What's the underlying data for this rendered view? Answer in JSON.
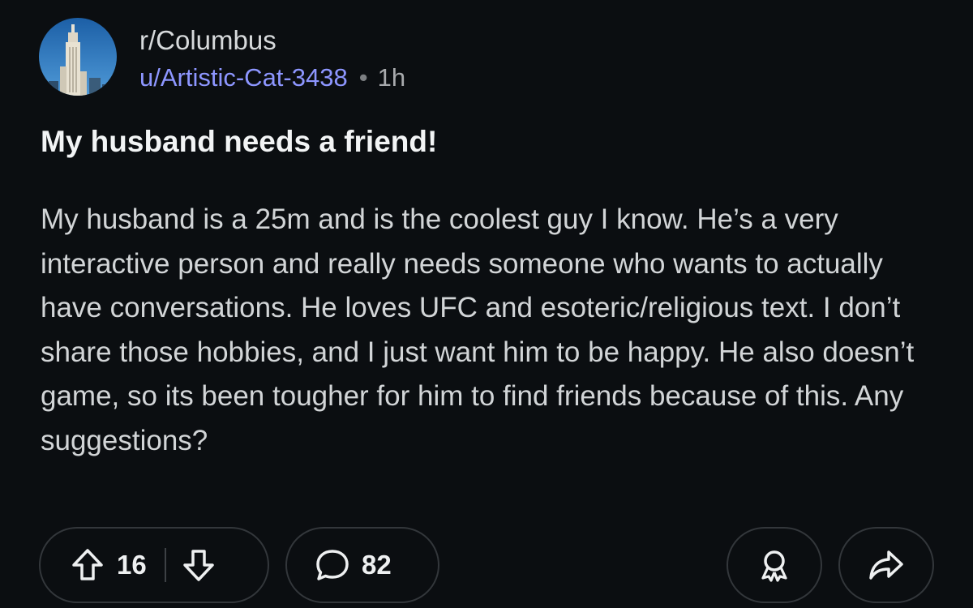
{
  "post": {
    "subreddit": "r/Columbus",
    "author": "u/Artistic-Cat-3438",
    "separator": "•",
    "age": "1h",
    "title": "My husband needs a friend!",
    "body": "My husband is a 25m and is the coolest guy I know. He’s a very interactive person and really needs someone who wants to actually have conversations. He loves UFC and esoteric/religious text. I don’t share those hobbies, and I just want him to be happy. He also doesn’t game, so its been tougher for him to find friends because of this. Any suggestions?"
  },
  "actions": {
    "upvote_icon": "arrow-up-icon",
    "vote_count": "16",
    "downvote_icon": "arrow-down-icon",
    "comment_icon": "speech-bubble-icon",
    "comment_count": "82",
    "award_icon": "award-ribbon-icon",
    "share_icon": "share-arrow-icon"
  },
  "colors": {
    "background": "#0b0e11",
    "username": "#8d96ff",
    "text": "#d2d5d7",
    "pill_border": "#33373b"
  }
}
